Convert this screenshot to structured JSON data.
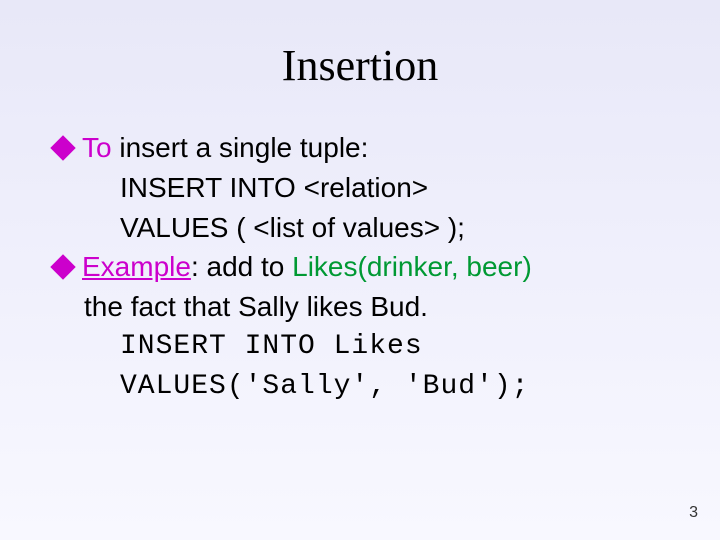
{
  "title": "Insertion",
  "bullets": {
    "b1": {
      "lead": "To",
      "rest": " insert a single tuple:"
    },
    "b2": {
      "lead": "Example",
      "rest1": ": add to ",
      "green": "Likes(drinker, beer)",
      "cont": "the fact that Sally likes Bud."
    }
  },
  "code1": {
    "l1": "INSERT INTO <relation>",
    "l2": "VALUES ( <list of values> );"
  },
  "code2": {
    "l1": "INSERT INTO Likes",
    "l2": "VALUES('Sally', 'Bud');"
  },
  "pageNumber": "3"
}
